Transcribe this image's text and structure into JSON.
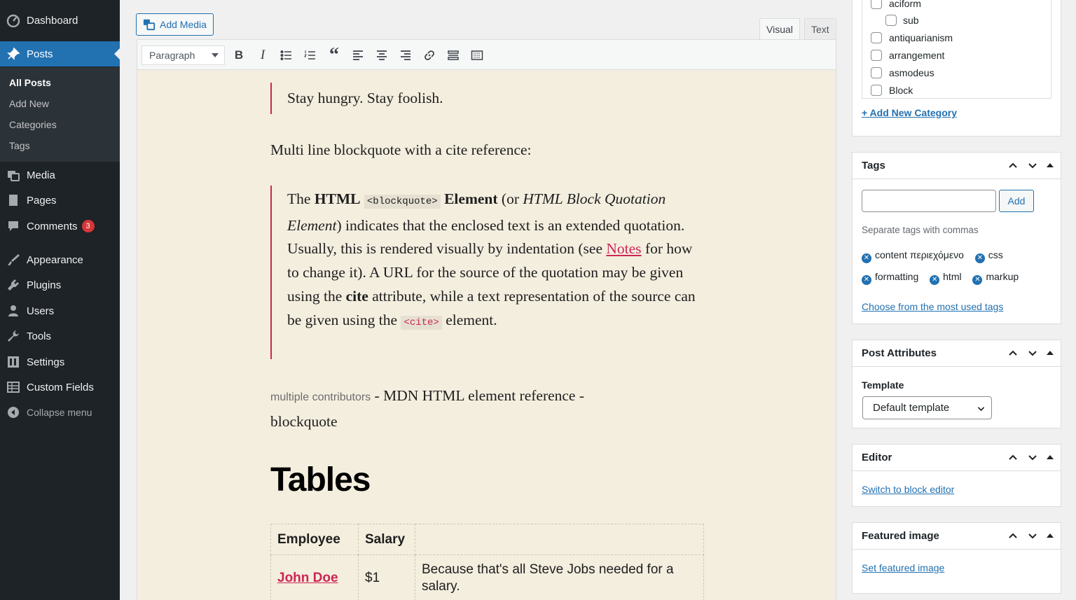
{
  "sidebar": {
    "items": [
      {
        "label": "Dashboard",
        "icon": "dashboard-icon"
      },
      {
        "label": "Posts",
        "icon": "pin-icon"
      },
      {
        "label": "Media",
        "icon": "media-icon"
      },
      {
        "label": "Pages",
        "icon": "pages-icon"
      },
      {
        "label": "Comments",
        "icon": "comments-icon",
        "badge": "3"
      },
      {
        "label": "Appearance",
        "icon": "brush-icon"
      },
      {
        "label": "Plugins",
        "icon": "plugin-icon"
      },
      {
        "label": "Users",
        "icon": "user-icon"
      },
      {
        "label": "Tools",
        "icon": "wrench-icon"
      },
      {
        "label": "Settings",
        "icon": "settings-icon"
      },
      {
        "label": "Custom Fields",
        "icon": "grid-icon"
      }
    ],
    "submenu": [
      "All Posts",
      "Add New",
      "Categories",
      "Tags"
    ],
    "collapse": "Collapse menu",
    "accent": "#2271b1"
  },
  "editor": {
    "add_media": "Add Media",
    "tabs": [
      "Visual",
      "Text"
    ],
    "format": "Paragraph",
    "quote1": "Stay hungry. Stay foolish.",
    "multi_line": "Multi line blockquote with a cite reference:",
    "bq": {
      "p1": "The ",
      "b1": "HTML",
      "code1": "<blockquote>",
      "b2": "Element",
      "p2": " (or ",
      "i1": "HTML Block Quotation Element",
      "p3": ") indicates that the enclosed text is an extended quotation. Usually, this is rendered visually by indentation (see ",
      "link": "Notes",
      "p4": " for how to change it). A URL for the source of the quotation may be given using the ",
      "b3": "cite",
      "p5": " attribute, while a text representation of the source can be given using the ",
      "code2": "<cite>",
      "p6": " element."
    },
    "contributors": "multiple contributors",
    "source": " - MDN HTML element reference - blockquote",
    "heading": "Tables",
    "table": {
      "headers": [
        "Employee",
        "Salary",
        ""
      ],
      "rows": [
        [
          "John Doe",
          "$1",
          "Because that's all Steve Jobs needed for a salary."
        ]
      ]
    },
    "background": "#f4eedf",
    "link_color": "#cd2653"
  },
  "categories": {
    "items": [
      "aciform",
      "sub",
      "antiquarianism",
      "arrangement",
      "asmodeus",
      "Block"
    ],
    "add_new": "+ Add New Category"
  },
  "tags_box": {
    "title": "Tags",
    "add": "Add",
    "hint": "Separate tags with commas",
    "tags": [
      "content περιεχόμενο",
      "css",
      "formatting",
      "html",
      "markup"
    ],
    "choose": "Choose from the most used tags"
  },
  "attributes_box": {
    "title": "Post Attributes",
    "template_label": "Template",
    "template_value": "Default template"
  },
  "editor_box": {
    "title": "Editor",
    "link": "Switch to block editor"
  },
  "featured_box": {
    "title": "Featured image",
    "link": "Set featured image"
  }
}
